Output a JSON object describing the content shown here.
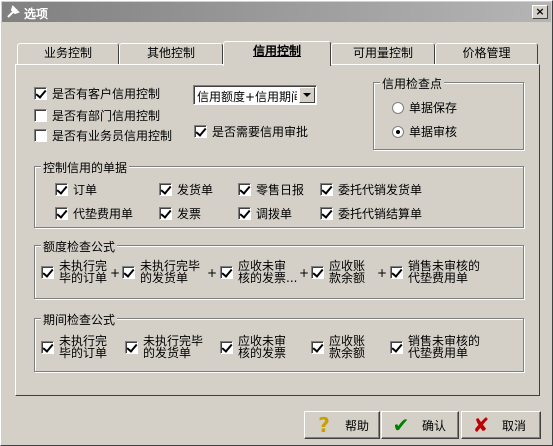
{
  "window": {
    "title": "选项",
    "close_label": "×"
  },
  "tabs": [
    {
      "label": "业务控制"
    },
    {
      "label": "其他控制"
    },
    {
      "label": "信用控制"
    },
    {
      "label": "可用量控制"
    },
    {
      "label": "价格管理"
    }
  ],
  "credit": {
    "customer_credit": {
      "label": "是否有客户信用控制",
      "checked": true
    },
    "dept_credit": {
      "label": "是否有部门信用控制",
      "checked": false
    },
    "salesman_credit": {
      "label": "是否有业务员信用控制",
      "checked": false
    },
    "need_approval": {
      "label": "是否需要信用审批",
      "checked": true
    },
    "control_mode": {
      "value": "信用额度+信用期间"
    }
  },
  "check_point": {
    "title": "信用检查点",
    "options": [
      {
        "label": "单据保存",
        "selected": false
      },
      {
        "label": "单据审核",
        "selected": true
      }
    ]
  },
  "docs_group": {
    "title": "控制信用的单据",
    "items": [
      {
        "label": "订单",
        "checked": true
      },
      {
        "label": "发货单",
        "checked": true
      },
      {
        "label": "零售日报",
        "checked": true
      },
      {
        "label": "委托代销发货单",
        "checked": true
      },
      {
        "label": "代垫费用单",
        "checked": true
      },
      {
        "label": "发票",
        "checked": true
      },
      {
        "label": "调拨单",
        "checked": true
      },
      {
        "label": "委托代销结算单",
        "checked": true
      }
    ]
  },
  "amount_formula": {
    "title": "额度检查公式",
    "items": [
      {
        "line1": "未执行完",
        "line2": "毕的订单",
        "checked": true
      },
      {
        "line1": "未执行完毕",
        "line2": "的发货单",
        "checked": true
      },
      {
        "line1": "应收未审",
        "line2": "核的发票...",
        "checked": true
      },
      {
        "line1": "应收账",
        "line2": "款余额",
        "checked": true
      },
      {
        "line1": "销售未审核的",
        "line2": "代垫费用单",
        "checked": true
      }
    ],
    "operator": "+"
  },
  "period_formula": {
    "title": "期间检查公式",
    "items": [
      {
        "line1": "未执行完",
        "line2": "毕的订单",
        "checked": true
      },
      {
        "line1": "未执行完毕",
        "line2": "的发货单",
        "checked": true
      },
      {
        "line1": "应收未审",
        "line2": "核的发票",
        "checked": true
      },
      {
        "line1": "应收账",
        "line2": "款余额",
        "checked": true
      },
      {
        "line1": "销售未审核的",
        "line2": "代垫费用单",
        "checked": true
      }
    ]
  },
  "buttons": {
    "help": {
      "label": "帮助",
      "icon": "?"
    },
    "ok": {
      "label": "确认",
      "icon": "✔"
    },
    "cancel": {
      "label": "取消",
      "icon": "✘"
    }
  },
  "colors": {
    "help_icon": "#c8a000",
    "ok_icon": "#008000",
    "cancel_icon": "#c00000"
  }
}
